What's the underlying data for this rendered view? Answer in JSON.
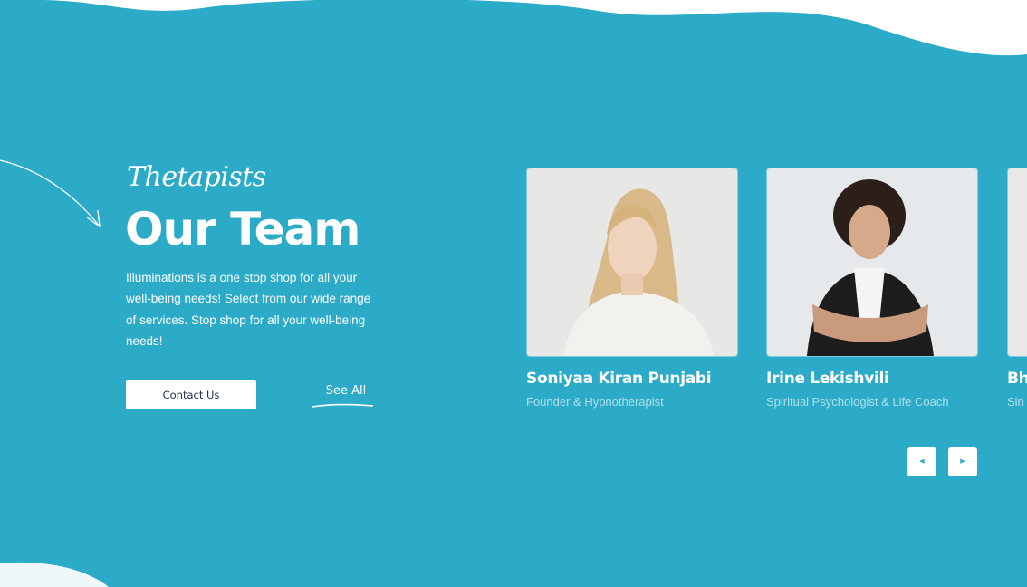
{
  "section": {
    "eyebrow": "Thetapists",
    "title": "Our Team",
    "description": "Illuminations is a one stop shop for all your well-being needs! Select from our wide range of services. Stop shop for all your well-being needs!",
    "contact_button": "Contact Us",
    "see_all_link": "See All"
  },
  "team": [
    {
      "name": "Soniyaa Kiran Punjabi",
      "role": "Founder & Hypnotherapist"
    },
    {
      "name": "Irine Lekishvili",
      "role": "Spiritual Psychologist & Life Coach"
    },
    {
      "name": "Bh",
      "role": "Sin"
    }
  ],
  "carousel": {
    "prev_icon": "caret-left-icon",
    "next_icon": "caret-right-icon"
  },
  "colors": {
    "background": "#2babc8",
    "wave": "#ffffff",
    "button_bg": "#ffffff",
    "button_text": "#1f3340"
  }
}
